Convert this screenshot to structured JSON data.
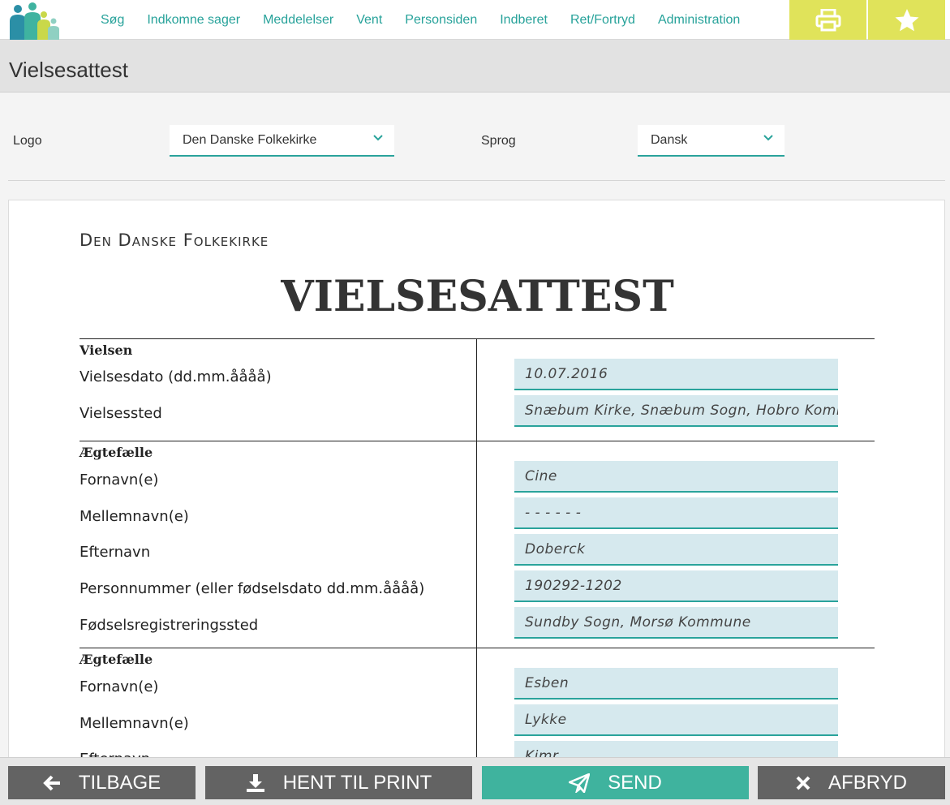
{
  "nav": {
    "items": [
      {
        "id": "soeg",
        "label": "Søg"
      },
      {
        "id": "indkomne",
        "label": "Indkomne sager"
      },
      {
        "id": "meddelelser",
        "label": "Meddelelser"
      },
      {
        "id": "vent",
        "label": "Vent"
      },
      {
        "id": "personsiden",
        "label": "Personsiden"
      },
      {
        "id": "indberet",
        "label": "Indberet"
      },
      {
        "id": "ret",
        "label": "Ret/Fortryd"
      },
      {
        "id": "administration",
        "label": "Administration"
      }
    ],
    "print_icon": "printer-icon",
    "favorite_icon": "star-icon",
    "accent_color": "#e0e35a",
    "link_color": "#27a29a"
  },
  "page": {
    "title": "Vielsesattest"
  },
  "options": {
    "logo_label": "Logo",
    "logo_value": "Den Danske Folkekirke",
    "language_label": "Sprog",
    "language_value": "Dansk"
  },
  "document": {
    "org": "Den Danske Folkekirke",
    "title": "VIELSESATTEST",
    "sections": {
      "vielsen": {
        "heading": "Vielsen",
        "date_label": "Vielsesdato (dd.mm.åååå)",
        "date_value": "10.07.2016",
        "place_label": "Vielsessted",
        "place_value": "Snæbum Kirke, Snæbum Sogn, Hobro Kommune"
      },
      "spouse1": {
        "heading": "Ægtefælle",
        "first_label": "Fornavn(e)",
        "first_value": "Cine",
        "middle_label": "Mellemnavn(e)",
        "middle_value": "- - - - - -",
        "last_label": "Efternavn",
        "last_value": "Doberck",
        "cpr_label": "Personnummer (eller fødselsdato dd.mm.åååå)",
        "cpr_value": "190292-1202",
        "birthplace_label": "Fødselsregistreringssted",
        "birthplace_value": "Sundby Sogn, Morsø Kommune"
      },
      "spouse2": {
        "heading": "Ægtefælle",
        "first_label": "Fornavn(e)",
        "first_value": "Esben",
        "middle_label": "Mellemnavn(e)",
        "middle_value": "Lykke",
        "last_label": "Efternavn",
        "last_value": "Kimr"
      }
    }
  },
  "footer": {
    "back_label": "TILBAGE",
    "download_label": "HENT TIL PRINT",
    "send_label": "SEND",
    "cancel_label": "AFBRYD",
    "send_color": "#3fb39e",
    "button_color": "#636363"
  }
}
